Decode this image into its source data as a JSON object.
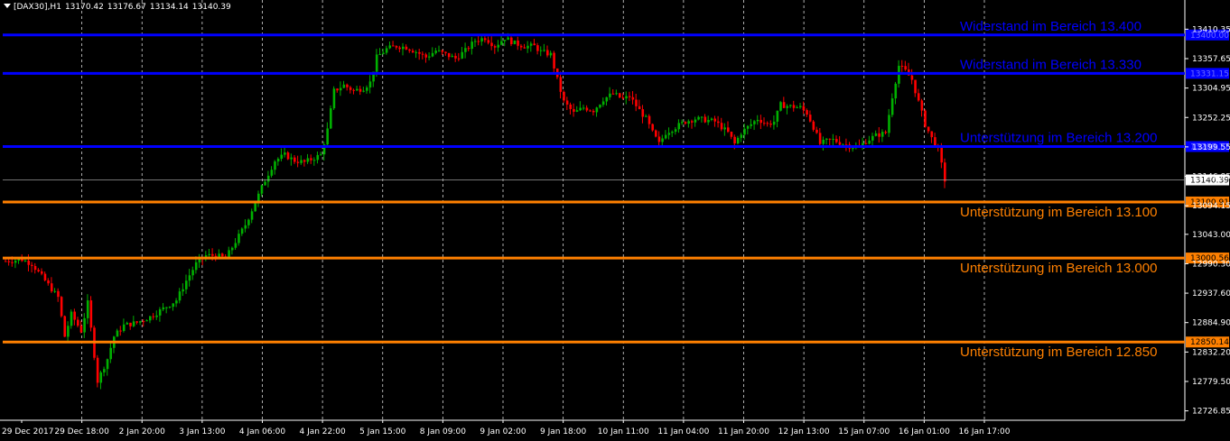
{
  "header": {
    "symbol": "[DAX30],H1",
    "open": "13170.42",
    "high": "13176.67",
    "low": "13134.14",
    "close": "13140.39"
  },
  "colors": {
    "background": "#000000",
    "bull": "#00b000",
    "bear": "#ff0000",
    "grid": "#ffffff",
    "resistance": "#0000ff",
    "support": "#ff8000"
  },
  "chart_data": {
    "type": "candlestick",
    "symbol": "[DAX30],H1",
    "ylim": [
      12710,
      13440
    ],
    "y_ticks": [
      "13410.35",
      "13357.65",
      "13304.95",
      "13252.25",
      "13199.55",
      "13146.85",
      "13094.15",
      "13043.00",
      "12990.30",
      "12937.60",
      "12884.90",
      "12832.20",
      "12779.50",
      "12726.85"
    ],
    "x_ticks": [
      "29 Dec 2017",
      "29 Dec 18:00",
      "2 Jan 20:00",
      "3 Jan 13:00",
      "4 Jan 06:00",
      "4 Jan 22:00",
      "5 Jan 15:00",
      "8 Jan 09:00",
      "9 Jan 02:00",
      "9 Jan 18:00",
      "10 Jan 11:00",
      "11 Jan 04:00",
      "11 Jan 20:00",
      "12 Jan 13:00",
      "15 Jan 07:00",
      "16 Jan 01:00",
      "16 Jan 17:00"
    ],
    "current_price": "13140.39",
    "levels": [
      {
        "price": 13400.0,
        "tag": "13400.00",
        "label": "Widerstand  im Bereich 13.400",
        "kind": "resistance"
      },
      {
        "price": 13331.15,
        "tag": "13331.15",
        "label": "Widerstand im Bereich 13.330",
        "kind": "resistance"
      },
      {
        "price": 13200.17,
        "tag": "13200.17",
        "label": "Unterstützung im Bereich 13.200",
        "kind": "support_blue"
      },
      {
        "price": 13100.91,
        "tag": "13100.91",
        "label": "Unterstützung im Bereich 13.100",
        "kind": "support"
      },
      {
        "price": 13000.56,
        "tag": "13000.56",
        "label": "Unterstützung im Bereich 13.000",
        "kind": "support"
      },
      {
        "price": 12850.14,
        "tag": "12850.14",
        "label": "Unterstützung im Bereich 12.850",
        "kind": "support"
      }
    ],
    "close_path": [
      [
        0,
        12995
      ],
      [
        5,
        12998
      ],
      [
        8,
        12990
      ],
      [
        12,
        12960
      ],
      [
        16,
        12930
      ],
      [
        18,
        12860
      ],
      [
        20,
        12900
      ],
      [
        23,
        12870
      ],
      [
        25,
        12920
      ],
      [
        28,
        12780
      ],
      [
        31,
        12820
      ],
      [
        33,
        12860
      ],
      [
        36,
        12880
      ],
      [
        40,
        12885
      ],
      [
        44,
        12895
      ],
      [
        48,
        12910
      ],
      [
        52,
        12925
      ],
      [
        55,
        12960
      ],
      [
        58,
        12990
      ],
      [
        61,
        13005
      ],
      [
        64,
        13005
      ],
      [
        67,
        13000
      ],
      [
        70,
        13030
      ],
      [
        73,
        13060
      ],
      [
        76,
        13100
      ],
      [
        79,
        13140
      ],
      [
        82,
        13175
      ],
      [
        85,
        13185
      ],
      [
        88,
        13175
      ],
      [
        91,
        13172
      ],
      [
        94,
        13180
      ],
      [
        96,
        13185
      ],
      [
        98,
        13230
      ],
      [
        100,
        13300
      ],
      [
        103,
        13310
      ],
      [
        106,
        13300
      ],
      [
        109,
        13305
      ],
      [
        111,
        13315
      ],
      [
        113,
        13360
      ],
      [
        116,
        13375
      ],
      [
        119,
        13380
      ],
      [
        122,
        13378
      ],
      [
        125,
        13370
      ],
      [
        128,
        13360
      ],
      [
        131,
        13372
      ],
      [
        134,
        13365
      ],
      [
        137,
        13358
      ],
      [
        140,
        13372
      ],
      [
        143,
        13390
      ],
      [
        146,
        13395
      ],
      [
        149,
        13380
      ],
      [
        152,
        13395
      ],
      [
        155,
        13385
      ],
      [
        158,
        13380
      ],
      [
        161,
        13380
      ],
      [
        163,
        13370
      ],
      [
        166,
        13365
      ],
      [
        168,
        13320
      ],
      [
        170,
        13280
      ],
      [
        173,
        13260
      ],
      [
        176,
        13270
      ],
      [
        179,
        13265
      ],
      [
        182,
        13285
      ],
      [
        185,
        13295
      ],
      [
        188,
        13285
      ],
      [
        190,
        13290
      ],
      [
        193,
        13265
      ],
      [
        195,
        13250
      ],
      [
        197,
        13225
      ],
      [
        199,
        13205
      ],
      [
        201,
        13225
      ],
      [
        204,
        13235
      ],
      [
        207,
        13245
      ],
      [
        210,
        13250
      ],
      [
        213,
        13248
      ],
      [
        216,
        13245
      ],
      [
        218,
        13235
      ],
      [
        220,
        13225
      ],
      [
        222,
        13205
      ],
      [
        224,
        13225
      ],
      [
        226,
        13235
      ],
      [
        229,
        13250
      ],
      [
        232,
        13240
      ],
      [
        234,
        13245
      ],
      [
        236,
        13275
      ],
      [
        239,
        13272
      ],
      [
        242,
        13270
      ],
      [
        244,
        13260
      ],
      [
        246,
        13235
      ],
      [
        248,
        13205
      ],
      [
        250,
        13210
      ],
      [
        252,
        13212
      ],
      [
        255,
        13205
      ],
      [
        258,
        13200
      ],
      [
        260,
        13200
      ],
      [
        262,
        13210
      ],
      [
        265,
        13220
      ],
      [
        268,
        13225
      ],
      [
        270,
        13290
      ],
      [
        272,
        13345
      ],
      [
        274,
        13335
      ],
      [
        276,
        13320
      ],
      [
        278,
        13280
      ],
      [
        280,
        13240
      ],
      [
        282,
        13215
      ],
      [
        284,
        13195
      ],
      [
        286,
        13140
      ]
    ]
  }
}
